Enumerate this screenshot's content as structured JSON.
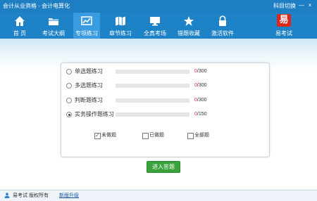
{
  "titlebar": {
    "title": "会计从业资格 - 会计电算化",
    "subject_switch": "科目切换",
    "minimize": "—",
    "close": "×"
  },
  "nav": {
    "items": [
      {
        "label": "首 页",
        "icon": "home-icon"
      },
      {
        "label": "考试大纲",
        "icon": "folder-icon"
      },
      {
        "label": "专项练习",
        "icon": "chart-icon"
      },
      {
        "label": "章节练习",
        "icon": "map-icon"
      },
      {
        "label": "全真考场",
        "icon": "monitor-icon"
      },
      {
        "label": "错题收藏",
        "icon": "star-icon"
      },
      {
        "label": "激活软件",
        "icon": "lock-icon"
      }
    ],
    "active_index": 2,
    "brand": {
      "badge": "易",
      "label": "易考试"
    }
  },
  "practice": {
    "types": [
      {
        "label": "单选题练习",
        "done": "0",
        "sep": "/",
        "total": "300",
        "progress": 0,
        "selected": false
      },
      {
        "label": "多选题练习",
        "done": "0",
        "sep": "/",
        "total": "300",
        "progress": 0,
        "selected": false
      },
      {
        "label": "判断题练习",
        "done": "0",
        "sep": "/",
        "total": "300",
        "progress": 0,
        "selected": false
      },
      {
        "label": "实务操作题练习",
        "done": "0",
        "sep": "/",
        "total": "150",
        "progress": 0,
        "selected": true
      }
    ],
    "filters": [
      {
        "label": "未做题",
        "checked": true
      },
      {
        "label": "已做题",
        "checked": false
      },
      {
        "label": "全部题",
        "checked": false
      }
    ],
    "enter_button": "进入答题"
  },
  "statusbar": {
    "brand": "易考试 版权所有",
    "upgrade": "新版升级"
  },
  "colors": {
    "nav_bg": "#1e82c7",
    "nav_active": "#3a9be0",
    "accent_green": "#3aa23a",
    "count_red": "#e03030",
    "brand_red": "#d9281c"
  }
}
